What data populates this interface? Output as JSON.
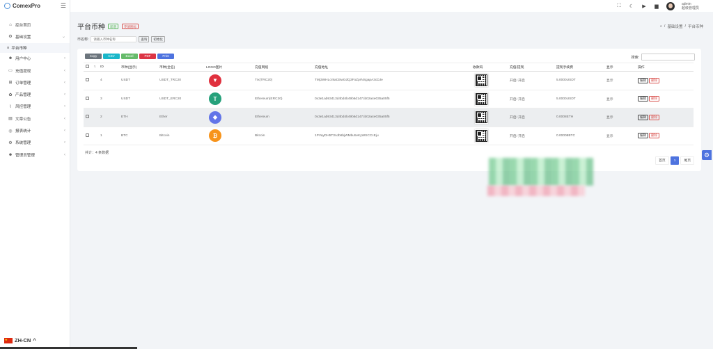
{
  "app": {
    "brand": "ComexPro"
  },
  "sidebar": {
    "items": [
      {
        "label": "控台首页",
        "icon": "home-icon",
        "glyph": "⌂"
      },
      {
        "label": "基础设置",
        "icon": "settings-icon",
        "glyph": "⚙"
      },
      {
        "label": "平台币种",
        "icon": "list-icon",
        "glyph": "≡"
      },
      {
        "label": "用户中心",
        "icon": "users-icon",
        "glyph": "☻"
      },
      {
        "label": "充值提现",
        "icon": "wallet-icon",
        "glyph": "▭"
      },
      {
        "label": "订单管理",
        "icon": "cart-icon",
        "glyph": "⊞"
      },
      {
        "label": "产品管理",
        "icon": "product-icon",
        "glyph": "✿"
      },
      {
        "label": "风控管理",
        "icon": "chart-icon",
        "glyph": "⌇"
      },
      {
        "label": "文章公告",
        "icon": "article-icon",
        "glyph": "▤"
      },
      {
        "label": "报表统计",
        "icon": "report-icon",
        "glyph": "◎"
      },
      {
        "label": "系统管理",
        "icon": "system-icon",
        "glyph": "⚙"
      },
      {
        "label": "管理员管理",
        "icon": "admins-icon",
        "glyph": "☻"
      }
    ],
    "language": "ZH-CN"
  },
  "topbar": {
    "user_name": "admin",
    "user_role": "超级管理员"
  },
  "page": {
    "title": "平台币种",
    "add_label": "新增",
    "recharge_label": "充值图标",
    "breadcrumb": [
      "基础设置",
      "平台币种"
    ],
    "filter_label": "币名称:",
    "filter_placeholder": "请输入币种名称",
    "query_label": "查询",
    "reset_label": "初始化"
  },
  "toolbar": {
    "exports": [
      "Copy",
      "CSV",
      "Excel",
      "PDF",
      "Print"
    ],
    "search_label": "搜索:"
  },
  "table": {
    "headers": [
      "",
      "ID",
      "币种(显示)",
      "币种(全名)",
      "LOGO图片",
      "充值网络",
      "充值地址",
      "收款码",
      "充值/提现",
      "提现手续费",
      "显示",
      "操作"
    ],
    "rows": [
      {
        "id": "4",
        "display": "USDT",
        "full": "USDT_TRC20",
        "logo": "tron",
        "logo_color": "#e0303e",
        "network": "Trx(TRC20)",
        "address": "TMj3WHLcr8aCBwGdQ3FoZprNSgapA3cDJe",
        "fee": "5.0000USDT",
        "status": "开启/ 开启",
        "show": "显示"
      },
      {
        "id": "3",
        "display": "USDT",
        "full": "USDT_ERC20",
        "logo": "tether",
        "logo_color": "#26a17b",
        "network": "Ethereum(ERC20)",
        "address": "0x3e1ab93413d4bd4b49b6d147cb02a4e035a05f5",
        "fee": "5.0000USDT",
        "status": "开启/ 开启",
        "show": "显示"
      },
      {
        "id": "2",
        "display": "ETH",
        "full": "Ether",
        "logo": "ethereum",
        "logo_color": "#6274e8",
        "network": "Ethereum",
        "address": "0x3e1ab93413d4bd4b49b6d147cb02a4e035a05f5",
        "fee": "0.0008ETH",
        "status": "开启/ 开启",
        "show": "显示"
      },
      {
        "id": "1",
        "display": "BTC",
        "full": "Bitcoin",
        "logo": "bitcoin",
        "logo_color": "#f7931a",
        "network": "Bitcoin",
        "address": "1PVayDH5T3nJb6bjWMbu5vKyWSCCcEju",
        "fee": "0.00008BTC",
        "status": "开启/ 开启",
        "show": "显示"
      }
    ],
    "edit_label": "编辑",
    "delete_label": "删除",
    "total_text": "共计：4 条数据"
  },
  "pagination": {
    "prev": "首页",
    "current": "1",
    "next": "尾页"
  },
  "colors": {
    "primary": "#4e73df",
    "danger": "#d9534f",
    "success": "#5cb85c"
  }
}
